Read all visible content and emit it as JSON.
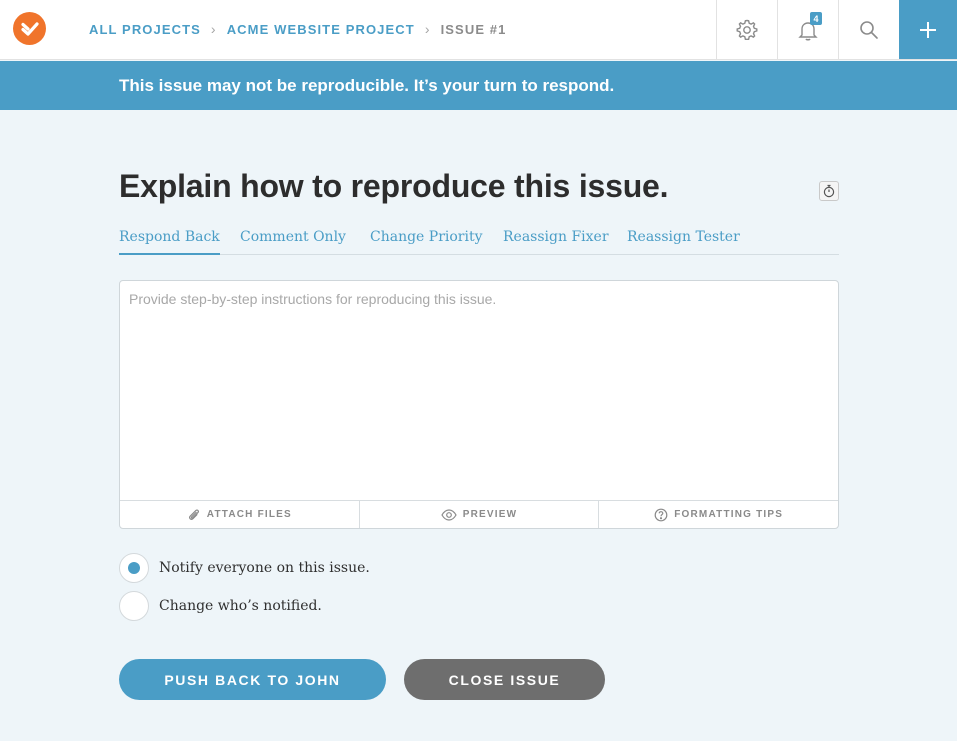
{
  "header": {
    "breadcrumb": {
      "all_projects": "ALL PROJECTS",
      "project": "ACME WEBSITE PROJECT",
      "issue": "ISSUE #1"
    },
    "icons": {
      "settings": "gear-icon",
      "notifications": "bell-icon",
      "search": "search-icon",
      "add": "plus-icon"
    },
    "notification_count": "4"
  },
  "banner": {
    "text": "This issue may not be reproducible. It’s your turn to respond."
  },
  "main": {
    "title": "Explain how to reproduce this issue.",
    "tabs": [
      {
        "label": "Respond Back",
        "active": true
      },
      {
        "label": "Comment Only",
        "active": false
      },
      {
        "label": "Change Priority",
        "active": false
      },
      {
        "label": "Reassign Fixer",
        "active": false
      },
      {
        "label": "Reassign Tester",
        "active": false
      }
    ],
    "editor": {
      "placeholder": "Provide step-by-step instructions for reproducing this issue.",
      "value": "",
      "tools": [
        {
          "label": "ATTACH FILES",
          "icon": "paperclip-icon"
        },
        {
          "label": "PREVIEW",
          "icon": "eye-icon"
        },
        {
          "label": "FORMATTING TIPS",
          "icon": "question-circle-icon"
        }
      ]
    },
    "notify_options": [
      {
        "label": "Notify everyone on this issue.",
        "selected": true
      },
      {
        "label": "Change who’s notified.",
        "selected": false
      }
    ],
    "actions": {
      "primary": "PUSH BACK TO JOHN",
      "secondary": "CLOSE ISSUE"
    }
  },
  "colors": {
    "accent": "#4a9dc6",
    "logo": "#f0742b",
    "background": "#eef5f9",
    "secondary_button": "#6e6e6e"
  }
}
